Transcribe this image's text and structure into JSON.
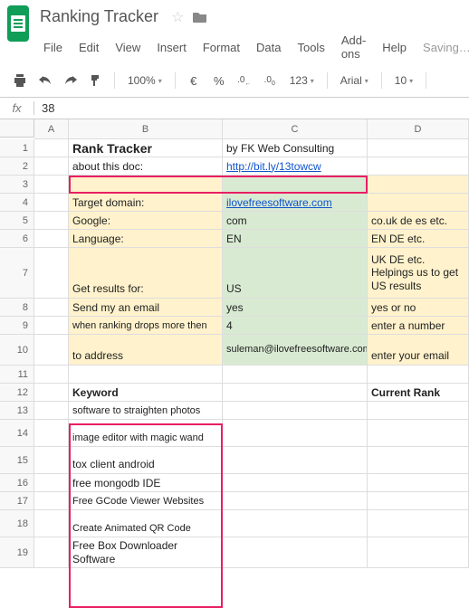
{
  "header": {
    "doc_title": "Ranking Tracker",
    "menu": [
      "File",
      "Edit",
      "View",
      "Insert",
      "Format",
      "Data",
      "Tools",
      "Add-ons",
      "Help"
    ],
    "status": "Saving…"
  },
  "toolbar": {
    "zoom": "100%",
    "currency": "€",
    "percent": "%",
    "dec_dec": ".0",
    "dec_inc": ".00",
    "num_fmt": "123",
    "font": "Arial",
    "size": "10"
  },
  "formula": {
    "label": "fx",
    "value": "38"
  },
  "columns": [
    "A",
    "B",
    "C",
    "D"
  ],
  "rows": [
    "1",
    "2",
    "3",
    "4",
    "5",
    "6",
    "7",
    "8",
    "9",
    "10",
    "11",
    "12",
    "13",
    "14",
    "15",
    "16",
    "17",
    "18",
    "19"
  ],
  "cells": {
    "B1": "Rank Tracker",
    "C1": "by FK Web Consulting",
    "B2": "about this doc:",
    "C2": "http://bit.ly/13towcw",
    "B4": "Target domain:",
    "C4": "ilovefreesoftware.com",
    "B5": "Google:",
    "C5": "com",
    "D5": "co.uk de es etc.",
    "B6": "Language:",
    "C6": "EN",
    "D6": "EN DE etc.",
    "B7": "Get results for:",
    "C7": "US",
    "D7": "UK DE etc. Helpings us to get US results",
    "B8": "Send my an email",
    "C8": "yes",
    "D8": "yes or no",
    "B9": "when ranking drops more then",
    "C9": "4",
    "D9": "enter a number",
    "B10": "to address",
    "C10": "suleman@ilovefreesoftware.com",
    "D10": "enter your email",
    "B12": "Keyword",
    "D12": "Current Rank",
    "B13": "software to straighten photos",
    "B14": "image editor with magic wand",
    "B15": "tox client android",
    "B16": "free mongodb IDE",
    "B17": "Free GCode Viewer Websites",
    "B18": "Create Animated QR Code",
    "B19": "Free Box Downloader Software"
  }
}
